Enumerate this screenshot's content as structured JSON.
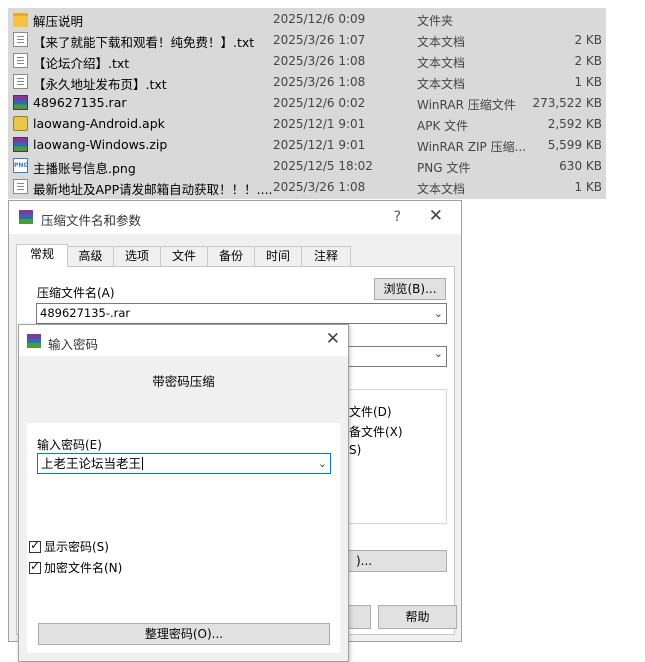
{
  "file_list": [
    {
      "icon": "folder-icon",
      "name": "解压说明",
      "date": "2025/12/6 0:09",
      "type": "文件夹",
      "size": ""
    },
    {
      "icon": "text-file-icon",
      "name": "【来了就能下载和观看！纯免费！】.txt",
      "date": "2025/3/26 1:07",
      "type": "文本文档",
      "size": "2 KB"
    },
    {
      "icon": "text-file-icon",
      "name": "【论坛介绍】.txt",
      "date": "2025/3/26 1:08",
      "type": "文本文档",
      "size": "2 KB"
    },
    {
      "icon": "text-file-icon",
      "name": "【永久地址发布页】.txt",
      "date": "2025/3/26 1:08",
      "type": "文本文档",
      "size": "1 KB"
    },
    {
      "icon": "winrar-archive-icon",
      "name": "489627135.rar",
      "date": "2025/12/6 0:02",
      "type": "WinRAR 压缩文件",
      "size": "273,522 KB"
    },
    {
      "icon": "apk-file-icon",
      "name": "laowang-Android.apk",
      "date": "2025/12/1 9:01",
      "type": "APK 文件",
      "size": "2,592 KB"
    },
    {
      "icon": "winrar-archive-icon",
      "name": "laowang-Windows.zip",
      "date": "2025/12/1 9:01",
      "type": "WinRAR ZIP 压缩...",
      "size": "5,599 KB"
    },
    {
      "icon": "png-file-icon",
      "name": "主播账号信息.png",
      "date": "2025/12/5 18:02",
      "type": "PNG 文件",
      "size": "630 KB"
    },
    {
      "icon": "text-file-icon",
      "name": "最新地址及APP请发邮箱自动获取！！！....",
      "date": "2025/3/26 1:08",
      "type": "文本文档",
      "size": "1 KB"
    }
  ],
  "main_dialog": {
    "title": "压缩文件名和参数",
    "help_glyph": "?",
    "close_glyph": "✕",
    "tabs": [
      "常规",
      "高级",
      "选项",
      "文件",
      "备份",
      "时间",
      "注释"
    ],
    "archive_name_label": "压缩文件名(A)",
    "browse_label": "浏览(B)...",
    "archive_name_value": "489627135-.rar",
    "partial_option_1": "文件(D)",
    "partial_option_2": "备文件(X)",
    "partial_option_3": "S)",
    "partial_button_label": ")...",
    "help_button_label": "帮助"
  },
  "password_dialog": {
    "title": "输入密码",
    "close_glyph": "✕",
    "heading": "带密码压缩",
    "password_label": "输入密码(E)",
    "password_value": "上老王论坛当老王",
    "show_password_label": "显示密码(S)",
    "show_password_checked": true,
    "encrypt_names_label": "加密文件名(N)",
    "encrypt_names_checked": true,
    "organize_button_label": "整理密码(O)..."
  }
}
